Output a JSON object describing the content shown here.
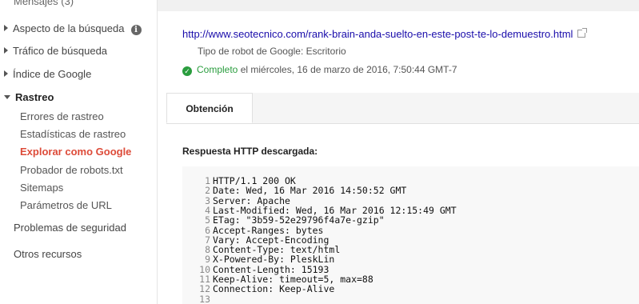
{
  "sidebar": {
    "items": [
      {
        "label": "Mensajes (3)"
      },
      {
        "label": "Aspecto de la búsqueda"
      },
      {
        "label": "Tráfico de búsqueda"
      },
      {
        "label": "Índice de Google"
      },
      {
        "label": "Rastreo"
      },
      {
        "label": "Errores de rastreo"
      },
      {
        "label": "Estadísticas de rastreo"
      },
      {
        "label": "Explorar como Google"
      },
      {
        "label": "Probador de robots.txt"
      },
      {
        "label": "Sitemaps"
      },
      {
        "label": "Parámetros de URL"
      },
      {
        "label": "Problemas de seguridad"
      },
      {
        "label": "Otros recursos"
      }
    ],
    "info_glyph": "i"
  },
  "main": {
    "url": "http://www.seotecnico.com/rank-brain-anda-suelto-en-este-post-te-lo-demuestro.html",
    "robot_type": "Tipo de robot de Google: Escritorio",
    "status_word": "Completo",
    "status_rest": " el miércoles, 16 de marzo de 2016, 7:50:44 GMT-7",
    "tab_label": "Obtención",
    "section_title": "Respuesta HTTP descargada:",
    "code_lines": [
      {
        "n": "1",
        "t": "HTTP/1.1 200 OK"
      },
      {
        "n": "2",
        "t": "Date: Wed, 16 Mar 2016 14:50:52 GMT"
      },
      {
        "n": "3",
        "t": "Server: Apache"
      },
      {
        "n": "4",
        "t": "Last-Modified: Wed, 16 Mar 2016 12:15:49 GMT"
      },
      {
        "n": "5",
        "t": "ETag: \"3b59-52e29796f4a7e-gzip\""
      },
      {
        "n": "6",
        "t": "Accept-Ranges: bytes"
      },
      {
        "n": "7",
        "t": "Vary: Accept-Encoding"
      },
      {
        "n": "8",
        "t": "Content-Type: text/html"
      },
      {
        "n": "9",
        "t": "X-Powered-By: PleskLin"
      },
      {
        "n": "10",
        "t": "Content-Length: 15193"
      },
      {
        "n": "11",
        "t": "Keep-Alive: timeout=5, max=88"
      },
      {
        "n": "12",
        "t": "Connection: Keep-Alive"
      },
      {
        "n": "13",
        "t": ""
      }
    ]
  },
  "colors": {
    "link": "#1a0dab",
    "active": "#dd4b39",
    "success": "#2a9d3e"
  },
  "icons": {
    "info": "info-icon",
    "external": "external-link-icon",
    "check": "check-circle-icon"
  }
}
